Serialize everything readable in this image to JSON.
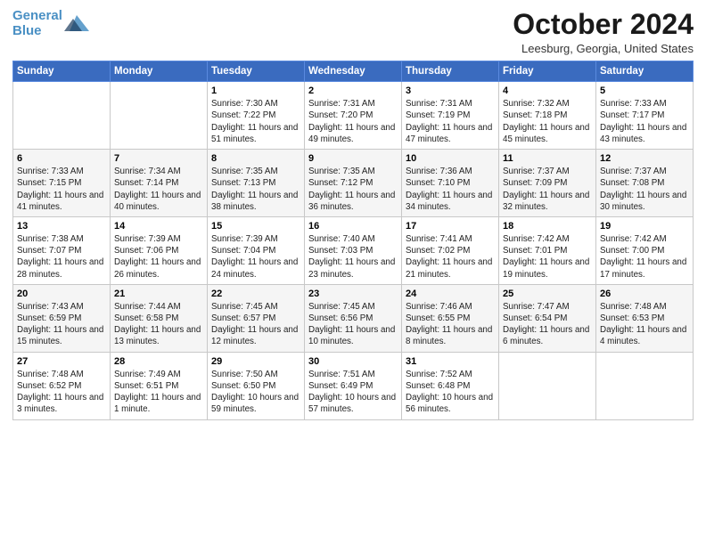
{
  "header": {
    "logo_line1": "General",
    "logo_line2": "Blue",
    "month": "October 2024",
    "location": "Leesburg, Georgia, United States"
  },
  "weekdays": [
    "Sunday",
    "Monday",
    "Tuesday",
    "Wednesday",
    "Thursday",
    "Friday",
    "Saturday"
  ],
  "weeks": [
    [
      {
        "day": "",
        "sunrise": "",
        "sunset": "",
        "daylight": ""
      },
      {
        "day": "",
        "sunrise": "",
        "sunset": "",
        "daylight": ""
      },
      {
        "day": "1",
        "sunrise": "Sunrise: 7:30 AM",
        "sunset": "Sunset: 7:22 PM",
        "daylight": "Daylight: 11 hours and 51 minutes."
      },
      {
        "day": "2",
        "sunrise": "Sunrise: 7:31 AM",
        "sunset": "Sunset: 7:20 PM",
        "daylight": "Daylight: 11 hours and 49 minutes."
      },
      {
        "day": "3",
        "sunrise": "Sunrise: 7:31 AM",
        "sunset": "Sunset: 7:19 PM",
        "daylight": "Daylight: 11 hours and 47 minutes."
      },
      {
        "day": "4",
        "sunrise": "Sunrise: 7:32 AM",
        "sunset": "Sunset: 7:18 PM",
        "daylight": "Daylight: 11 hours and 45 minutes."
      },
      {
        "day": "5",
        "sunrise": "Sunrise: 7:33 AM",
        "sunset": "Sunset: 7:17 PM",
        "daylight": "Daylight: 11 hours and 43 minutes."
      }
    ],
    [
      {
        "day": "6",
        "sunrise": "Sunrise: 7:33 AM",
        "sunset": "Sunset: 7:15 PM",
        "daylight": "Daylight: 11 hours and 41 minutes."
      },
      {
        "day": "7",
        "sunrise": "Sunrise: 7:34 AM",
        "sunset": "Sunset: 7:14 PM",
        "daylight": "Daylight: 11 hours and 40 minutes."
      },
      {
        "day": "8",
        "sunrise": "Sunrise: 7:35 AM",
        "sunset": "Sunset: 7:13 PM",
        "daylight": "Daylight: 11 hours and 38 minutes."
      },
      {
        "day": "9",
        "sunrise": "Sunrise: 7:35 AM",
        "sunset": "Sunset: 7:12 PM",
        "daylight": "Daylight: 11 hours and 36 minutes."
      },
      {
        "day": "10",
        "sunrise": "Sunrise: 7:36 AM",
        "sunset": "Sunset: 7:10 PM",
        "daylight": "Daylight: 11 hours and 34 minutes."
      },
      {
        "day": "11",
        "sunrise": "Sunrise: 7:37 AM",
        "sunset": "Sunset: 7:09 PM",
        "daylight": "Daylight: 11 hours and 32 minutes."
      },
      {
        "day": "12",
        "sunrise": "Sunrise: 7:37 AM",
        "sunset": "Sunset: 7:08 PM",
        "daylight": "Daylight: 11 hours and 30 minutes."
      }
    ],
    [
      {
        "day": "13",
        "sunrise": "Sunrise: 7:38 AM",
        "sunset": "Sunset: 7:07 PM",
        "daylight": "Daylight: 11 hours and 28 minutes."
      },
      {
        "day": "14",
        "sunrise": "Sunrise: 7:39 AM",
        "sunset": "Sunset: 7:06 PM",
        "daylight": "Daylight: 11 hours and 26 minutes."
      },
      {
        "day": "15",
        "sunrise": "Sunrise: 7:39 AM",
        "sunset": "Sunset: 7:04 PM",
        "daylight": "Daylight: 11 hours and 24 minutes."
      },
      {
        "day": "16",
        "sunrise": "Sunrise: 7:40 AM",
        "sunset": "Sunset: 7:03 PM",
        "daylight": "Daylight: 11 hours and 23 minutes."
      },
      {
        "day": "17",
        "sunrise": "Sunrise: 7:41 AM",
        "sunset": "Sunset: 7:02 PM",
        "daylight": "Daylight: 11 hours and 21 minutes."
      },
      {
        "day": "18",
        "sunrise": "Sunrise: 7:42 AM",
        "sunset": "Sunset: 7:01 PM",
        "daylight": "Daylight: 11 hours and 19 minutes."
      },
      {
        "day": "19",
        "sunrise": "Sunrise: 7:42 AM",
        "sunset": "Sunset: 7:00 PM",
        "daylight": "Daylight: 11 hours and 17 minutes."
      }
    ],
    [
      {
        "day": "20",
        "sunrise": "Sunrise: 7:43 AM",
        "sunset": "Sunset: 6:59 PM",
        "daylight": "Daylight: 11 hours and 15 minutes."
      },
      {
        "day": "21",
        "sunrise": "Sunrise: 7:44 AM",
        "sunset": "Sunset: 6:58 PM",
        "daylight": "Daylight: 11 hours and 13 minutes."
      },
      {
        "day": "22",
        "sunrise": "Sunrise: 7:45 AM",
        "sunset": "Sunset: 6:57 PM",
        "daylight": "Daylight: 11 hours and 12 minutes."
      },
      {
        "day": "23",
        "sunrise": "Sunrise: 7:45 AM",
        "sunset": "Sunset: 6:56 PM",
        "daylight": "Daylight: 11 hours and 10 minutes."
      },
      {
        "day": "24",
        "sunrise": "Sunrise: 7:46 AM",
        "sunset": "Sunset: 6:55 PM",
        "daylight": "Daylight: 11 hours and 8 minutes."
      },
      {
        "day": "25",
        "sunrise": "Sunrise: 7:47 AM",
        "sunset": "Sunset: 6:54 PM",
        "daylight": "Daylight: 11 hours and 6 minutes."
      },
      {
        "day": "26",
        "sunrise": "Sunrise: 7:48 AM",
        "sunset": "Sunset: 6:53 PM",
        "daylight": "Daylight: 11 hours and 4 minutes."
      }
    ],
    [
      {
        "day": "27",
        "sunrise": "Sunrise: 7:48 AM",
        "sunset": "Sunset: 6:52 PM",
        "daylight": "Daylight: 11 hours and 3 minutes."
      },
      {
        "day": "28",
        "sunrise": "Sunrise: 7:49 AM",
        "sunset": "Sunset: 6:51 PM",
        "daylight": "Daylight: 11 hours and 1 minute."
      },
      {
        "day": "29",
        "sunrise": "Sunrise: 7:50 AM",
        "sunset": "Sunset: 6:50 PM",
        "daylight": "Daylight: 10 hours and 59 minutes."
      },
      {
        "day": "30",
        "sunrise": "Sunrise: 7:51 AM",
        "sunset": "Sunset: 6:49 PM",
        "daylight": "Daylight: 10 hours and 57 minutes."
      },
      {
        "day": "31",
        "sunrise": "Sunrise: 7:52 AM",
        "sunset": "Sunset: 6:48 PM",
        "daylight": "Daylight: 10 hours and 56 minutes."
      },
      {
        "day": "",
        "sunrise": "",
        "sunset": "",
        "daylight": ""
      },
      {
        "day": "",
        "sunrise": "",
        "sunset": "",
        "daylight": ""
      }
    ]
  ]
}
